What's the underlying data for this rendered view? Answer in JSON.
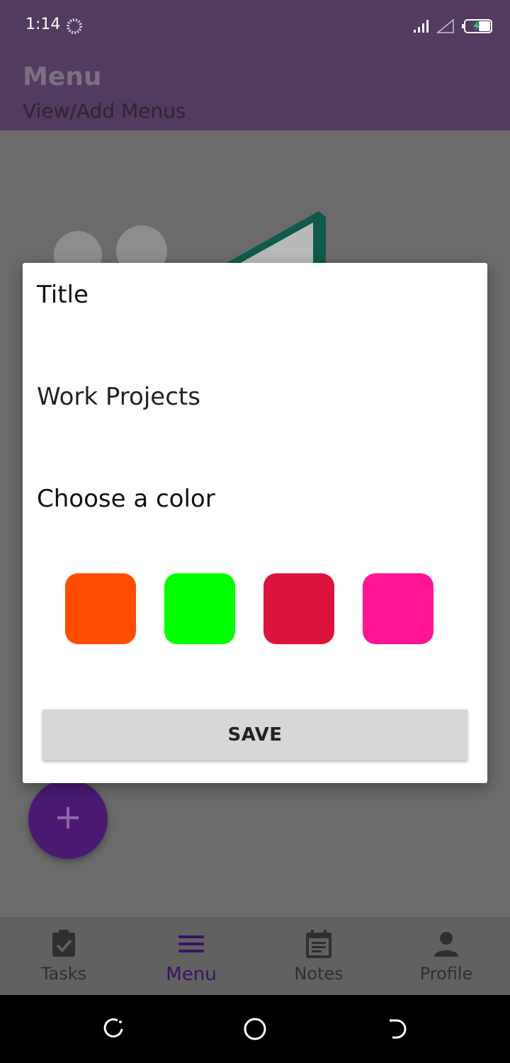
{
  "status_bar": {
    "time": "1:14",
    "icons": [
      "loading-spinner-icon",
      "signal-icon",
      "signal-outline-icon",
      "battery-charging-icon"
    ]
  },
  "app_bar": {
    "title": "Menu",
    "subtitle": "View/Add Menus"
  },
  "dialog": {
    "title_label": "Title",
    "title_value": "Work Projects",
    "color_label": "Choose a color",
    "colors": [
      "#ff4d00",
      "#00ff00",
      "#dc143c",
      "#ff1493"
    ],
    "save_label": "SAVE"
  },
  "fab": {
    "icon": "plus-icon",
    "label": "+"
  },
  "bottom_nav": {
    "items": [
      {
        "label": "Tasks",
        "icon": "clipboard-check-icon",
        "active": false
      },
      {
        "label": "Menu",
        "icon": "menu-icon",
        "active": true
      },
      {
        "label": "Notes",
        "icon": "calendar-note-icon",
        "active": false
      },
      {
        "label": "Profile",
        "icon": "person-icon",
        "active": false
      }
    ]
  },
  "colors": {
    "app_bar": "#523a60",
    "accent": "#3b1169",
    "fab": "#4a1a72"
  }
}
